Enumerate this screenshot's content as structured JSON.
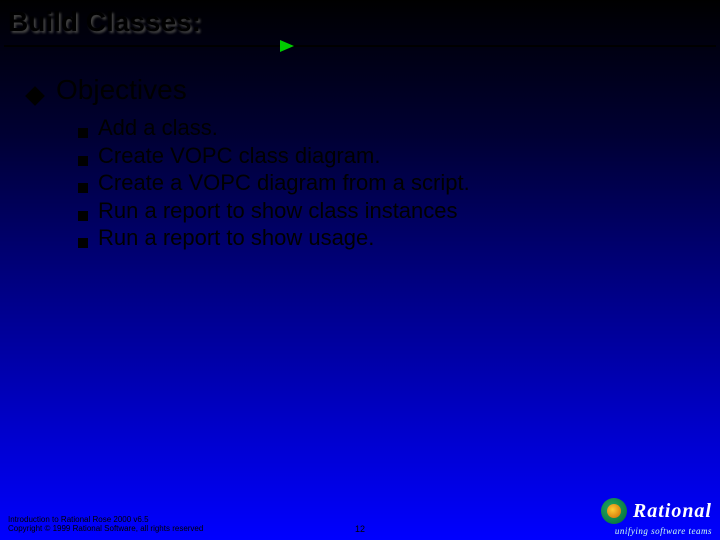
{
  "title": "Build Classes:",
  "level1": "Objectives",
  "bullets": [
    "Add a class.",
    "Create VOPC class diagram.",
    "Create a VOPC diagram from a script.",
    "Run a report to show class instances",
    "Run a report to show usage."
  ],
  "footer": {
    "line1": "Introduction to Rational Rose 2000 v6.5",
    "line2": "Copyright © 1999 Rational Software, all rights reserved",
    "page": "12"
  },
  "logo": {
    "name": "Rational",
    "tagline": "unifying software teams"
  }
}
